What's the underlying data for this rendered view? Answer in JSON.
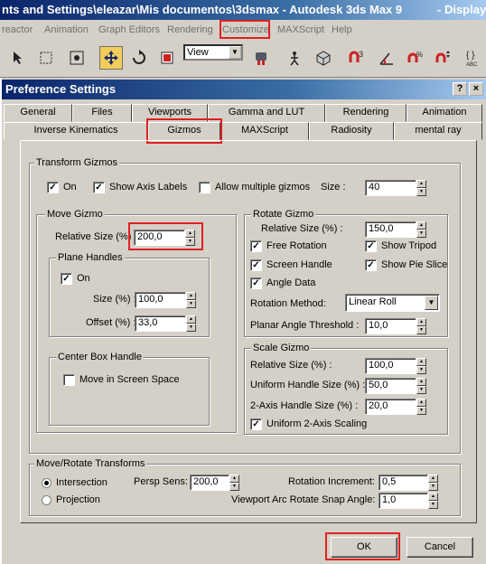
{
  "app": {
    "title": "nts and Settings\\eleazar\\Mis documentos\\3dsmax     - Autodesk 3ds Max 9",
    "title_right": "- Display"
  },
  "menu": [
    "reactor",
    "Animation",
    "Graph Editors",
    "Rendering",
    "Customize",
    "MAXScript",
    "Help"
  ],
  "toolbar": {
    "view_select": "View",
    "icons": [
      "select-region-icon",
      "rect-select-icon",
      "select-circle-icon",
      "move-icon",
      "rotate-icon",
      "scale-icon",
      "view-dropdown",
      "mirror-icon",
      "align-icon",
      "layers-icon",
      "snap3-icon",
      "angle-snap-icon",
      "percent-snap-icon",
      "spinner-snap-icon",
      "named-selection-icon"
    ]
  },
  "dialog": {
    "title": "Preference Settings",
    "help_btn": "?",
    "close_btn": "×",
    "tabs_row1": [
      "General",
      "Files",
      "Viewports",
      "Gamma and LUT",
      "Rendering",
      "Animation"
    ],
    "tabs_row2": [
      "Inverse Kinematics",
      "Gizmos",
      "MAXScript",
      "Radiosity",
      "mental ray"
    ],
    "active_tab": "Gizmos"
  },
  "transform": {
    "group": "Transform Gizmos",
    "on": "On",
    "show_axis": "Show Axis Labels",
    "allow_multiple": "Allow multiple gizmos",
    "size_label": "Size :",
    "size_value": "40"
  },
  "move": {
    "group": "Move Gizmo",
    "relative_label": "Relative Size (%) :",
    "relative_value": "200,0",
    "plane_group": "Plane Handles",
    "plane_on": "On",
    "size_label": "Size (%) :",
    "size_value": "100,0",
    "offset_label": "Offset (%) :",
    "offset_value": "33,0",
    "center_group": "Center Box Handle",
    "move_screen": "Move in Screen Space"
  },
  "rotate": {
    "group": "Rotate Gizmo",
    "relative_label": "Relative Size (%) :",
    "relative_value": "150,0",
    "free_rotation": "Free Rotation",
    "show_tripod": "Show Tripod",
    "screen_handle": "Screen Handle",
    "show_pie": "Show Pie Slice",
    "angle_data": "Angle Data",
    "method_label": "Rotation Method:",
    "method_value": "Linear Roll",
    "planar_label": "Planar Angle Threshold :",
    "planar_value": "10,0"
  },
  "scale": {
    "group": "Scale Gizmo",
    "relative_label": "Relative Size (%) :",
    "relative_value": "100,0",
    "uniform_label": "Uniform Handle Size (%) :",
    "uniform_value": "50,0",
    "twoaxis_label": "2-Axis Handle Size (%) :",
    "twoaxis_value": "20,0",
    "uniform_scaling": "Uniform 2-Axis Scaling"
  },
  "moverotate": {
    "group": "Move/Rotate Transforms",
    "intersection": "Intersection",
    "projection": "Projection",
    "persp_label": "Persp Sens:",
    "persp_value": "200,0",
    "rot_inc_label": "Rotation Increment:",
    "rot_inc_value": "0,5",
    "arc_label": "Viewport Arc Rotate Snap Angle:",
    "arc_value": "1,0"
  },
  "buttons": {
    "ok": "OK",
    "cancel": "Cancel"
  }
}
